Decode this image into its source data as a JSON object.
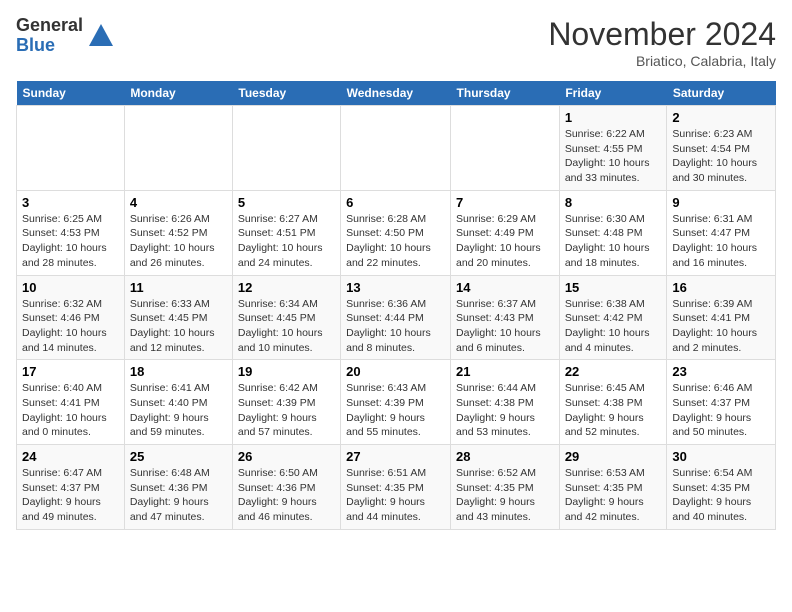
{
  "logo": {
    "general": "General",
    "blue": "Blue"
  },
  "header": {
    "title": "November 2024",
    "location": "Briatico, Calabria, Italy"
  },
  "days_of_week": [
    "Sunday",
    "Monday",
    "Tuesday",
    "Wednesday",
    "Thursday",
    "Friday",
    "Saturday"
  ],
  "weeks": [
    [
      {
        "day": "",
        "info": ""
      },
      {
        "day": "",
        "info": ""
      },
      {
        "day": "",
        "info": ""
      },
      {
        "day": "",
        "info": ""
      },
      {
        "day": "",
        "info": ""
      },
      {
        "day": "1",
        "info": "Sunrise: 6:22 AM\nSunset: 4:55 PM\nDaylight: 10 hours and 33 minutes."
      },
      {
        "day": "2",
        "info": "Sunrise: 6:23 AM\nSunset: 4:54 PM\nDaylight: 10 hours and 30 minutes."
      }
    ],
    [
      {
        "day": "3",
        "info": "Sunrise: 6:25 AM\nSunset: 4:53 PM\nDaylight: 10 hours and 28 minutes."
      },
      {
        "day": "4",
        "info": "Sunrise: 6:26 AM\nSunset: 4:52 PM\nDaylight: 10 hours and 26 minutes."
      },
      {
        "day": "5",
        "info": "Sunrise: 6:27 AM\nSunset: 4:51 PM\nDaylight: 10 hours and 24 minutes."
      },
      {
        "day": "6",
        "info": "Sunrise: 6:28 AM\nSunset: 4:50 PM\nDaylight: 10 hours and 22 minutes."
      },
      {
        "day": "7",
        "info": "Sunrise: 6:29 AM\nSunset: 4:49 PM\nDaylight: 10 hours and 20 minutes."
      },
      {
        "day": "8",
        "info": "Sunrise: 6:30 AM\nSunset: 4:48 PM\nDaylight: 10 hours and 18 minutes."
      },
      {
        "day": "9",
        "info": "Sunrise: 6:31 AM\nSunset: 4:47 PM\nDaylight: 10 hours and 16 minutes."
      }
    ],
    [
      {
        "day": "10",
        "info": "Sunrise: 6:32 AM\nSunset: 4:46 PM\nDaylight: 10 hours and 14 minutes."
      },
      {
        "day": "11",
        "info": "Sunrise: 6:33 AM\nSunset: 4:45 PM\nDaylight: 10 hours and 12 minutes."
      },
      {
        "day": "12",
        "info": "Sunrise: 6:34 AM\nSunset: 4:45 PM\nDaylight: 10 hours and 10 minutes."
      },
      {
        "day": "13",
        "info": "Sunrise: 6:36 AM\nSunset: 4:44 PM\nDaylight: 10 hours and 8 minutes."
      },
      {
        "day": "14",
        "info": "Sunrise: 6:37 AM\nSunset: 4:43 PM\nDaylight: 10 hours and 6 minutes."
      },
      {
        "day": "15",
        "info": "Sunrise: 6:38 AM\nSunset: 4:42 PM\nDaylight: 10 hours and 4 minutes."
      },
      {
        "day": "16",
        "info": "Sunrise: 6:39 AM\nSunset: 4:41 PM\nDaylight: 10 hours and 2 minutes."
      }
    ],
    [
      {
        "day": "17",
        "info": "Sunrise: 6:40 AM\nSunset: 4:41 PM\nDaylight: 10 hours and 0 minutes."
      },
      {
        "day": "18",
        "info": "Sunrise: 6:41 AM\nSunset: 4:40 PM\nDaylight: 9 hours and 59 minutes."
      },
      {
        "day": "19",
        "info": "Sunrise: 6:42 AM\nSunset: 4:39 PM\nDaylight: 9 hours and 57 minutes."
      },
      {
        "day": "20",
        "info": "Sunrise: 6:43 AM\nSunset: 4:39 PM\nDaylight: 9 hours and 55 minutes."
      },
      {
        "day": "21",
        "info": "Sunrise: 6:44 AM\nSunset: 4:38 PM\nDaylight: 9 hours and 53 minutes."
      },
      {
        "day": "22",
        "info": "Sunrise: 6:45 AM\nSunset: 4:38 PM\nDaylight: 9 hours and 52 minutes."
      },
      {
        "day": "23",
        "info": "Sunrise: 6:46 AM\nSunset: 4:37 PM\nDaylight: 9 hours and 50 minutes."
      }
    ],
    [
      {
        "day": "24",
        "info": "Sunrise: 6:47 AM\nSunset: 4:37 PM\nDaylight: 9 hours and 49 minutes."
      },
      {
        "day": "25",
        "info": "Sunrise: 6:48 AM\nSunset: 4:36 PM\nDaylight: 9 hours and 47 minutes."
      },
      {
        "day": "26",
        "info": "Sunrise: 6:50 AM\nSunset: 4:36 PM\nDaylight: 9 hours and 46 minutes."
      },
      {
        "day": "27",
        "info": "Sunrise: 6:51 AM\nSunset: 4:35 PM\nDaylight: 9 hours and 44 minutes."
      },
      {
        "day": "28",
        "info": "Sunrise: 6:52 AM\nSunset: 4:35 PM\nDaylight: 9 hours and 43 minutes."
      },
      {
        "day": "29",
        "info": "Sunrise: 6:53 AM\nSunset: 4:35 PM\nDaylight: 9 hours and 42 minutes."
      },
      {
        "day": "30",
        "info": "Sunrise: 6:54 AM\nSunset: 4:35 PM\nDaylight: 9 hours and 40 minutes."
      }
    ]
  ]
}
